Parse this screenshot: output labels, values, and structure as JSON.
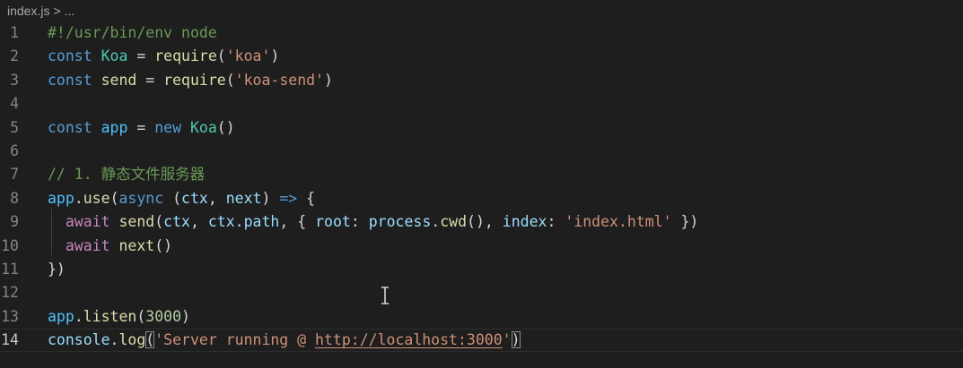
{
  "breadcrumb": {
    "file": "index.js",
    "separator": ">",
    "rest": "..."
  },
  "theme": {
    "background": "#1e1e1e",
    "comment": "#6a9955",
    "keyword": "#569cd6",
    "class": "#4ec9b0",
    "function": "#dcdcaa",
    "string": "#ce9178",
    "variable": "#9cdcfe",
    "number": "#b5cea8",
    "control": "#c586c0",
    "plain": "#d4d4d4"
  },
  "cursor_icon": "text-cursor-icon",
  "current_line": 14,
  "lines": [
    {
      "number": "1",
      "tokens": [
        {
          "t": "#!/usr/bin/env node",
          "c": "comment"
        }
      ]
    },
    {
      "number": "2",
      "tokens": [
        {
          "t": "const",
          "c": "keyword"
        },
        {
          "t": " ",
          "c": "plain"
        },
        {
          "t": "Koa",
          "c": "class"
        },
        {
          "t": " = ",
          "c": "plain"
        },
        {
          "t": "require",
          "c": "func"
        },
        {
          "t": "(",
          "c": "plain"
        },
        {
          "t": "'koa'",
          "c": "string"
        },
        {
          "t": ")",
          "c": "plain"
        }
      ]
    },
    {
      "number": "3",
      "tokens": [
        {
          "t": "const",
          "c": "keyword"
        },
        {
          "t": " ",
          "c": "plain"
        },
        {
          "t": "send",
          "c": "func"
        },
        {
          "t": " = ",
          "c": "plain"
        },
        {
          "t": "require",
          "c": "func"
        },
        {
          "t": "(",
          "c": "plain"
        },
        {
          "t": "'koa-send'",
          "c": "string"
        },
        {
          "t": ")",
          "c": "plain"
        }
      ]
    },
    {
      "number": "4",
      "tokens": []
    },
    {
      "number": "5",
      "tokens": [
        {
          "t": "const",
          "c": "keyword"
        },
        {
          "t": " ",
          "c": "plain"
        },
        {
          "t": "app",
          "c": "const"
        },
        {
          "t": " = ",
          "c": "plain"
        },
        {
          "t": "new",
          "c": "keyword"
        },
        {
          "t": " ",
          "c": "plain"
        },
        {
          "t": "Koa",
          "c": "class"
        },
        {
          "t": "()",
          "c": "plain"
        }
      ]
    },
    {
      "number": "6",
      "tokens": []
    },
    {
      "number": "7",
      "tokens": [
        {
          "t": "// 1. 静态文件服务器",
          "c": "comment"
        }
      ]
    },
    {
      "number": "8",
      "tokens": [
        {
          "t": "app",
          "c": "const"
        },
        {
          "t": ".",
          "c": "plain"
        },
        {
          "t": "use",
          "c": "func"
        },
        {
          "t": "(",
          "c": "plain"
        },
        {
          "t": "async",
          "c": "keyword"
        },
        {
          "t": " (",
          "c": "plain"
        },
        {
          "t": "ctx",
          "c": "var"
        },
        {
          "t": ", ",
          "c": "plain"
        },
        {
          "t": "next",
          "c": "var"
        },
        {
          "t": ") ",
          "c": "plain"
        },
        {
          "t": "=>",
          "c": "keyword"
        },
        {
          "t": " {",
          "c": "plain"
        }
      ]
    },
    {
      "number": "9",
      "tokens": [
        {
          "t": "  ",
          "c": "plain"
        },
        {
          "t": "await",
          "c": "control"
        },
        {
          "t": " ",
          "c": "plain"
        },
        {
          "t": "send",
          "c": "func"
        },
        {
          "t": "(",
          "c": "plain"
        },
        {
          "t": "ctx",
          "c": "var"
        },
        {
          "t": ", ",
          "c": "plain"
        },
        {
          "t": "ctx",
          "c": "var"
        },
        {
          "t": ".",
          "c": "plain"
        },
        {
          "t": "path",
          "c": "var"
        },
        {
          "t": ", { ",
          "c": "plain"
        },
        {
          "t": "root",
          "c": "var"
        },
        {
          "t": ": ",
          "c": "plain"
        },
        {
          "t": "process",
          "c": "var"
        },
        {
          "t": ".",
          "c": "plain"
        },
        {
          "t": "cwd",
          "c": "func"
        },
        {
          "t": "(), ",
          "c": "plain"
        },
        {
          "t": "index",
          "c": "var"
        },
        {
          "t": ": ",
          "c": "plain"
        },
        {
          "t": "'index.html'",
          "c": "string"
        },
        {
          "t": " })",
          "c": "plain"
        }
      ]
    },
    {
      "number": "10",
      "tokens": [
        {
          "t": "  ",
          "c": "plain"
        },
        {
          "t": "await",
          "c": "control"
        },
        {
          "t": " ",
          "c": "plain"
        },
        {
          "t": "next",
          "c": "func"
        },
        {
          "t": "()",
          "c": "plain"
        }
      ]
    },
    {
      "number": "11",
      "tokens": [
        {
          "t": "})",
          "c": "plain"
        }
      ]
    },
    {
      "number": "12",
      "tokens": []
    },
    {
      "number": "13",
      "tokens": [
        {
          "t": "app",
          "c": "const"
        },
        {
          "t": ".",
          "c": "plain"
        },
        {
          "t": "listen",
          "c": "func"
        },
        {
          "t": "(",
          "c": "plain"
        },
        {
          "t": "3000",
          "c": "number"
        },
        {
          "t": ")",
          "c": "plain"
        }
      ]
    },
    {
      "number": "14",
      "tokens": [
        {
          "t": "console",
          "c": "var"
        },
        {
          "t": ".",
          "c": "plain"
        },
        {
          "t": "log",
          "c": "func"
        },
        {
          "t": "(",
          "c": "bracket-match"
        },
        {
          "t": "'Server running @ ",
          "c": "string"
        },
        {
          "t": "http://localhost:3000",
          "c": "link"
        },
        {
          "t": "'",
          "c": "string"
        },
        {
          "t": ")",
          "c": "bracket-match"
        }
      ]
    }
  ]
}
